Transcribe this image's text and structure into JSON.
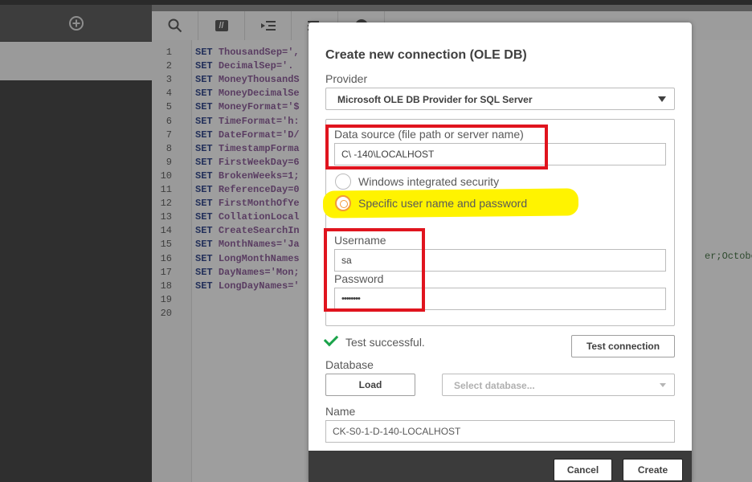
{
  "toolbar": {
    "icons": [
      "search-icon",
      "comment-toggle-icon",
      "indent-icon",
      "outdent-icon",
      "help-icon"
    ],
    "comment_glyph": "//"
  },
  "editor": {
    "line_numbers": [
      "1",
      "2",
      "3",
      "4",
      "5",
      "6",
      "7",
      "8",
      "9",
      "10",
      "11",
      "12",
      "13",
      "14",
      "15",
      "16",
      "17",
      "18",
      "19",
      "20"
    ],
    "lines": [
      {
        "kw": "SET",
        "text": "ThousandSep=',"
      },
      {
        "kw": "SET",
        "text": "DecimalSep='."
      },
      {
        "kw": "SET",
        "text": "MoneyThousandS"
      },
      {
        "kw": "SET",
        "text": "MoneyDecimalSe"
      },
      {
        "kw": "SET",
        "text": "MoneyFormat='$"
      },
      {
        "kw": "SET",
        "text": "TimeFormat='h:"
      },
      {
        "kw": "SET",
        "text": "DateFormat='D/"
      },
      {
        "kw": "SET",
        "text": "TimestampForma"
      },
      {
        "kw": "SET",
        "text": "FirstWeekDay=6"
      },
      {
        "kw": "SET",
        "text": "BrokenWeeks=1;"
      },
      {
        "kw": "SET",
        "text": "ReferenceDay=0"
      },
      {
        "kw": "SET",
        "text": "FirstMonthOfYe"
      },
      {
        "kw": "SET",
        "text": "CollationLocal"
      },
      {
        "kw": "SET",
        "text": "CreateSearchIn"
      },
      {
        "kw": "SET",
        "text": "MonthNames='Ja"
      },
      {
        "kw": "SET",
        "text": "LongMonthNames"
      },
      {
        "kw": "SET",
        "text": "DayNames='Mon;"
      },
      {
        "kw": "SET",
        "text": "LongDayNames='"
      }
    ],
    "line16_tail": "er;October"
  },
  "dialog": {
    "title": "Create new connection (OLE DB)",
    "provider_label": "Provider",
    "provider_value": "Microsoft OLE DB Provider for SQL Server",
    "datasource_label": "Data source (file path or server name)",
    "datasource_value": "C\\              -140\\LOCALHOST",
    "auth_options": [
      {
        "label": "Windows integrated security",
        "selected": false
      },
      {
        "label": "Specific user name and password",
        "selected": true
      }
    ],
    "username_label": "Username",
    "username_value": "sa",
    "password_label": "Password",
    "password_value": "••••••••",
    "test_status": "Test successful.",
    "test_button": "Test connection",
    "database_label": "Database",
    "load_button": "Load",
    "database_placeholder": "Select database...",
    "name_label": "Name",
    "name_value": "CK-S0-1-D-140-LOCALHOST",
    "cancel_button": "Cancel",
    "create_button": "Create"
  },
  "colors": {
    "accent_radio": "#f29a3a",
    "success": "#1aa34a",
    "annotation_red": "#e0141e",
    "annotation_yellow": "#fff300"
  }
}
